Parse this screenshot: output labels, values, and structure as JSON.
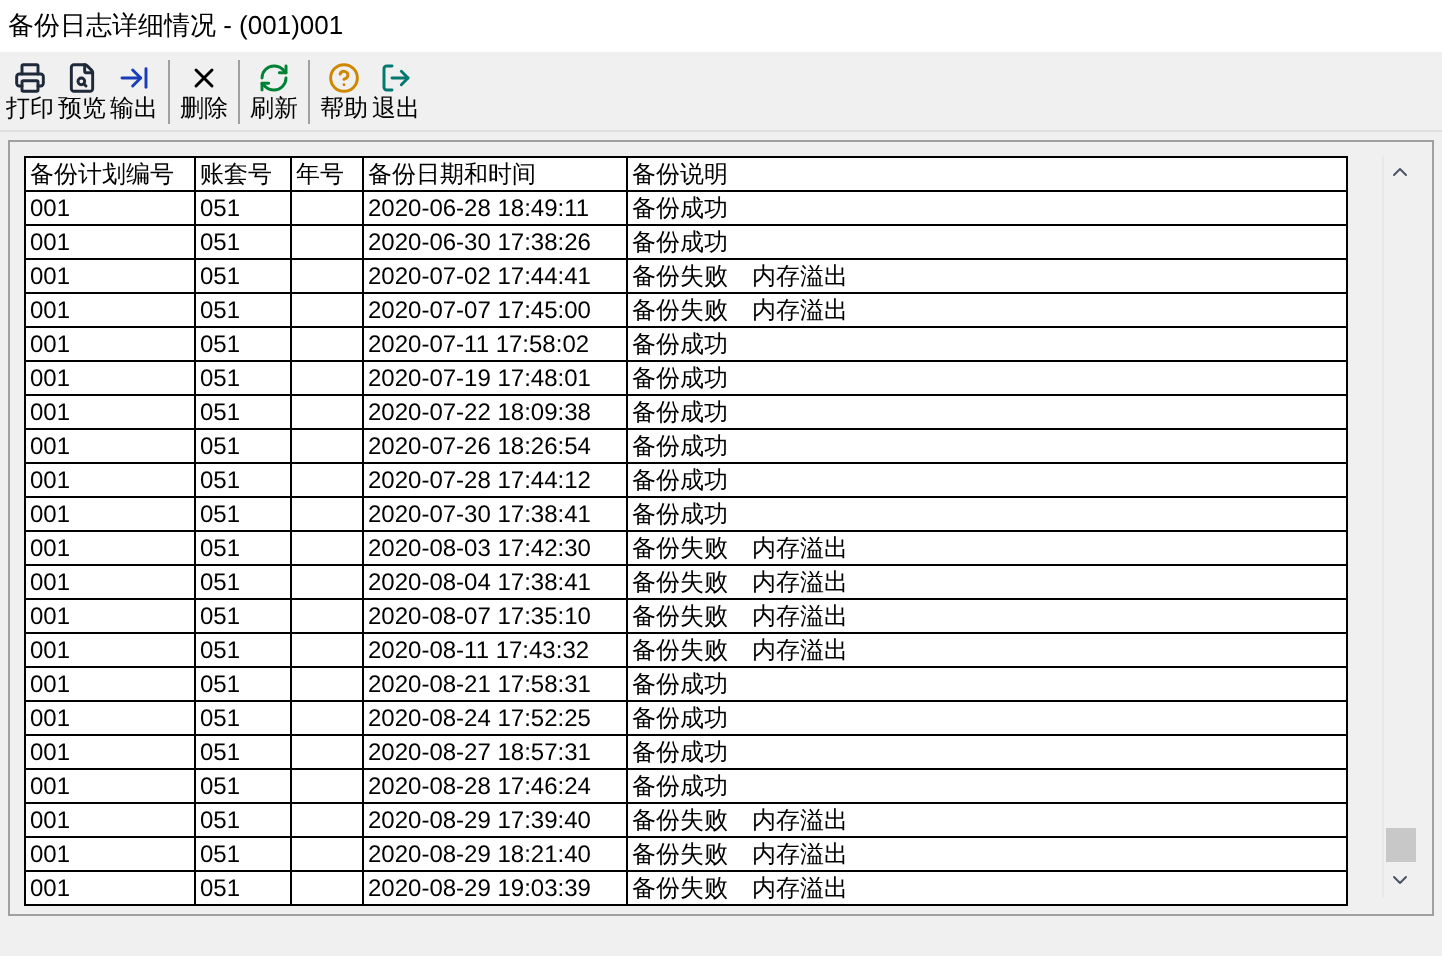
{
  "window": {
    "title": "备份日志详细情况 - (001)001"
  },
  "toolbar": [
    {
      "buttons": [
        "打印",
        "预览",
        "输出"
      ]
    },
    {
      "buttons": [
        "删除"
      ]
    },
    {
      "buttons": [
        "刷新"
      ]
    },
    {
      "buttons": [
        "帮助",
        "退出"
      ]
    }
  ],
  "table": {
    "columns": [
      "备份计划编号",
      "账套号",
      "年号",
      "备份日期和时间",
      "备份说明"
    ],
    "rows": [
      [
        "001",
        "051",
        "",
        "2020-06-28 18:49:11",
        "备份成功"
      ],
      [
        "001",
        "051",
        "",
        "2020-06-30 17:38:26",
        "备份成功"
      ],
      [
        "001",
        "051",
        "",
        "2020-07-02 17:44:41",
        "备份失败　内存溢出"
      ],
      [
        "001",
        "051",
        "",
        "2020-07-07 17:45:00",
        "备份失败　内存溢出"
      ],
      [
        "001",
        "051",
        "",
        "2020-07-11 17:58:02",
        "备份成功"
      ],
      [
        "001",
        "051",
        "",
        "2020-07-19 17:48:01",
        "备份成功"
      ],
      [
        "001",
        "051",
        "",
        "2020-07-22 18:09:38",
        "备份成功"
      ],
      [
        "001",
        "051",
        "",
        "2020-07-26 18:26:54",
        "备份成功"
      ],
      [
        "001",
        "051",
        "",
        "2020-07-28 17:44:12",
        "备份成功"
      ],
      [
        "001",
        "051",
        "",
        "2020-07-30 17:38:41",
        "备份成功"
      ],
      [
        "001",
        "051",
        "",
        "2020-08-03 17:42:30",
        "备份失败　内存溢出"
      ],
      [
        "001",
        "051",
        "",
        "2020-08-04 17:38:41",
        "备份失败　内存溢出"
      ],
      [
        "001",
        "051",
        "",
        "2020-08-07 17:35:10",
        "备份失败　内存溢出"
      ],
      [
        "001",
        "051",
        "",
        "2020-08-11 17:43:32",
        "备份失败　内存溢出"
      ],
      [
        "001",
        "051",
        "",
        "2020-08-21 17:58:31",
        "备份成功"
      ],
      [
        "001",
        "051",
        "",
        "2020-08-24 17:52:25",
        "备份成功"
      ],
      [
        "001",
        "051",
        "",
        "2020-08-27 18:57:31",
        "备份成功"
      ],
      [
        "001",
        "051",
        "",
        "2020-08-28 17:46:24",
        "备份成功"
      ],
      [
        "001",
        "051",
        "",
        "2020-08-29 17:39:40",
        "备份失败　内存溢出"
      ],
      [
        "001",
        "051",
        "",
        "2020-08-29 18:21:40",
        "备份失败　内存溢出"
      ],
      [
        "001",
        "051",
        "",
        "2020-08-29 19:03:39",
        "备份失败　内存溢出"
      ]
    ]
  }
}
